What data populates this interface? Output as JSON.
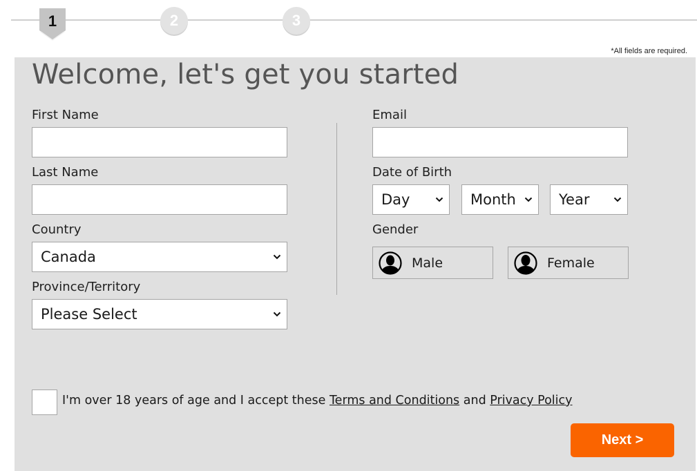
{
  "stepper": {
    "steps": [
      {
        "number": "1",
        "state": "active"
      },
      {
        "number": "2",
        "state": "inactive"
      },
      {
        "number": "3",
        "state": "inactive"
      }
    ]
  },
  "required_note": "*All fields are required.",
  "form": {
    "title": "Welcome, let's get you started",
    "first_name": {
      "label": "First Name",
      "value": ""
    },
    "last_name": {
      "label": "Last Name",
      "value": ""
    },
    "country": {
      "label": "Country",
      "selected": "Canada"
    },
    "province": {
      "label": "Province/Territory",
      "selected": "Please Select"
    },
    "email": {
      "label": "Email",
      "value": ""
    },
    "dob": {
      "label": "Date of Birth",
      "day": "Day",
      "month": "Month",
      "year": "Year"
    },
    "gender": {
      "label": "Gender",
      "options": [
        "Male",
        "Female"
      ]
    },
    "consent": {
      "checked": false,
      "text_before": "I'm over 18 years of age and I accept these ",
      "terms_link": "Terms and Conditions",
      "text_middle": " and ",
      "privacy_link": "Privacy Policy"
    },
    "next_label": "Next >"
  },
  "colors": {
    "accent": "#fa6400",
    "panel_bg": "#e0e0e0",
    "title_color": "#555555"
  }
}
